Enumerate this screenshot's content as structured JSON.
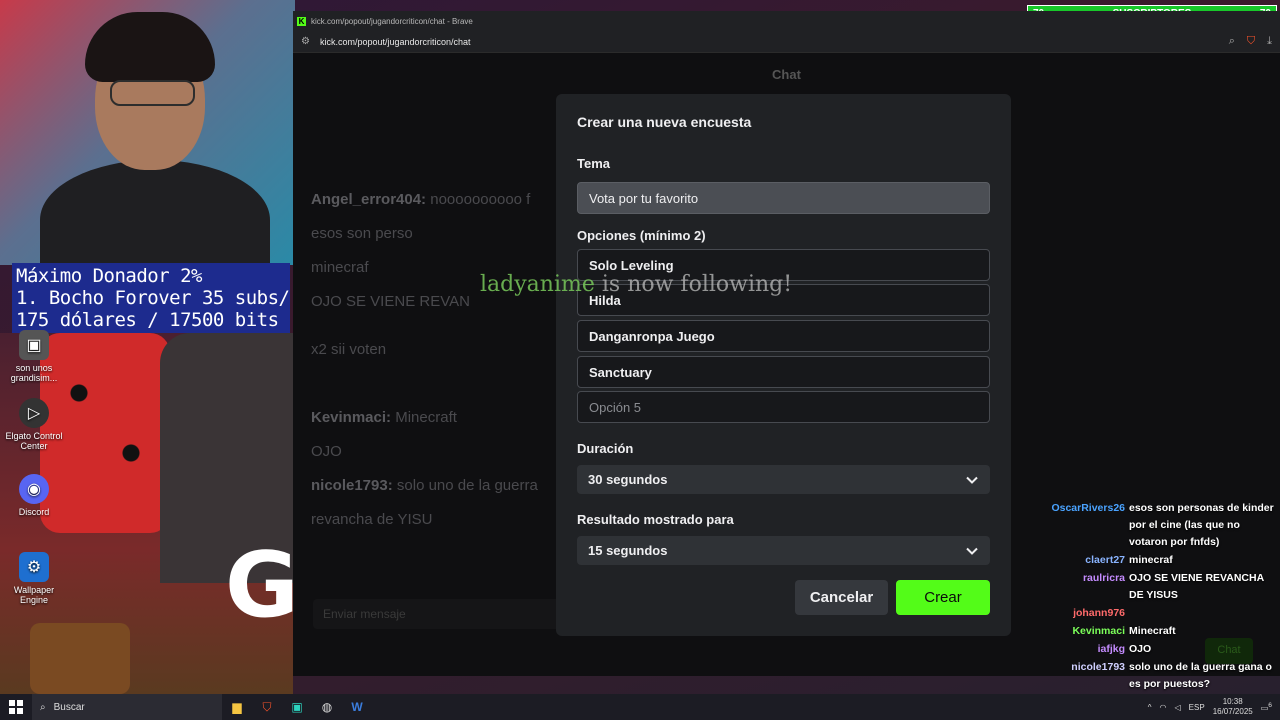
{
  "browser": {
    "tab_title": "kick.com/popout/jugandorcriticon/chat - Brave",
    "url": "kick.com/popout/jugandorcriticon/chat"
  },
  "chat": {
    "heading": "Chat",
    "background_lines": [
      {
        "user": "Angel_error404:",
        "text": "noooooooooo f"
      },
      {
        "user": "",
        "text": "esos son perso"
      },
      {
        "user": "",
        "text": "minecraf"
      },
      {
        "user": "",
        "text": "OJO SE VIENE REVAN"
      },
      {
        "user": "",
        "text": "x2 sii voten"
      },
      {
        "user": "Kevinmaci:",
        "text": "Minecraft"
      },
      {
        "user": "",
        "text": "OJO"
      },
      {
        "user": "nicole1793:",
        "text": "solo uno de la guerra"
      },
      {
        "user": "",
        "text": "revancha de YISU"
      }
    ],
    "input_placeholder": "Enviar mensaje",
    "send_label": "Chat"
  },
  "modal": {
    "title": "Crear una nueva encuesta",
    "topic_label": "Tema",
    "topic_value": "Vota por tu favorito",
    "options_label": "Opciones (mínimo 2)",
    "options": [
      "Solo Leveling",
      "Hilda",
      "Danganronpa Juego",
      "Sanctuary"
    ],
    "option5_placeholder": "Opción 5",
    "duration_label": "Duración",
    "duration_value": "30 segundos",
    "result_label": "Resultado mostrado para",
    "result_value": "15 segundos",
    "cancel_label": "Cancelar",
    "create_label": "Crear"
  },
  "alert": {
    "name": "ladyanime",
    "text": " is now following!"
  },
  "donor_box": {
    "line1": "Máximo Donador 2%",
    "line2": "1. Bocho Forover 35 subs/",
    "line3": "175 dólares / 17500 bits"
  },
  "sub_counter": {
    "left": "70",
    "label": "SUSCRIPTORES",
    "right": "70"
  },
  "overlay_chat": [
    {
      "user": "OscarRivers26",
      "color": "#4aa3ff",
      "text": "esos son personas de kinder por el cine (las que no votaron por fnfds)"
    },
    {
      "user": "claert27",
      "color": "#8ab4ff",
      "text": "minecraf"
    },
    {
      "user": "raulricra",
      "color": "#c58cff",
      "text": "OJO SE VIENE REVANCHA DE YISUS"
    },
    {
      "user": "johann976",
      "color": "#ff6b6b",
      "text": ""
    },
    {
      "user": "Kevinmaci",
      "color": "#7cff5a",
      "text": "Minecraft"
    },
    {
      "user": "iafjkg",
      "color": "#c58cff",
      "text": "OJO"
    },
    {
      "user": "nicole1793",
      "color": "#d0d0ff",
      "text": "solo uno de la guerra gana o es por puestos?"
    }
  ],
  "desktop_icons": [
    {
      "label": "son unos grandisim..."
    },
    {
      "label": "Elgato Control Center"
    },
    {
      "label": "Discord"
    },
    {
      "label": "Wallpaper Engine"
    }
  ],
  "taskbar": {
    "search_label": "Buscar",
    "language": "ESP",
    "time": "10:38",
    "date": "16/07/2025",
    "notification_count": "6"
  },
  "colors": {
    "kick_green": "#53fc18",
    "modal_bg": "#202225",
    "donor_blue": "#1d2b8e"
  }
}
